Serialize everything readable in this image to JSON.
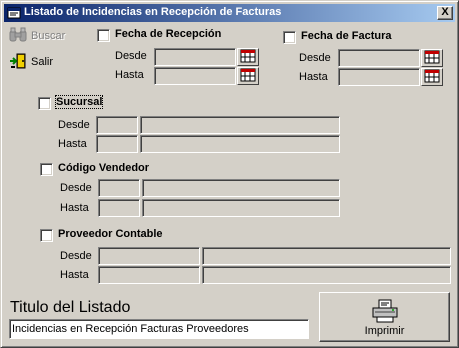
{
  "window": {
    "title": "Listado de Incidencias en Recepción de Facturas",
    "close_glyph": "X"
  },
  "toolbar": {
    "buscar_label": "Buscar",
    "salir_label": "Salir"
  },
  "fecha_recepcion": {
    "label": "Fecha de Recepción",
    "desde": "Desde",
    "hasta": "Hasta"
  },
  "fecha_factura": {
    "label": "Fecha de Factura",
    "desde": "Desde",
    "hasta": "Hasta"
  },
  "sucursal": {
    "label": "Sucursal",
    "desde": "Desde",
    "hasta": "Hasta"
  },
  "codigo_vendedor": {
    "label": "Código Vendedor",
    "desde": "Desde",
    "hasta": "Hasta"
  },
  "proveedor_contable": {
    "label": "Proveedor Contable",
    "desde": "Desde",
    "hasta": "Hasta"
  },
  "titulo": {
    "label": "Titulo del Listado",
    "value": "Incidencias en Recepción Facturas Proveedores"
  },
  "imprimir_label": "Imprimir",
  "colors": {
    "face": "#d4d0c8",
    "title_start": "#0a246a",
    "title_end": "#a6caf0"
  },
  "icons": {
    "window": "form-icon",
    "buscar": "binoculars-icon",
    "salir": "exit-door-icon",
    "calendar": "calendar-icon",
    "imprimir": "printer-icon"
  }
}
